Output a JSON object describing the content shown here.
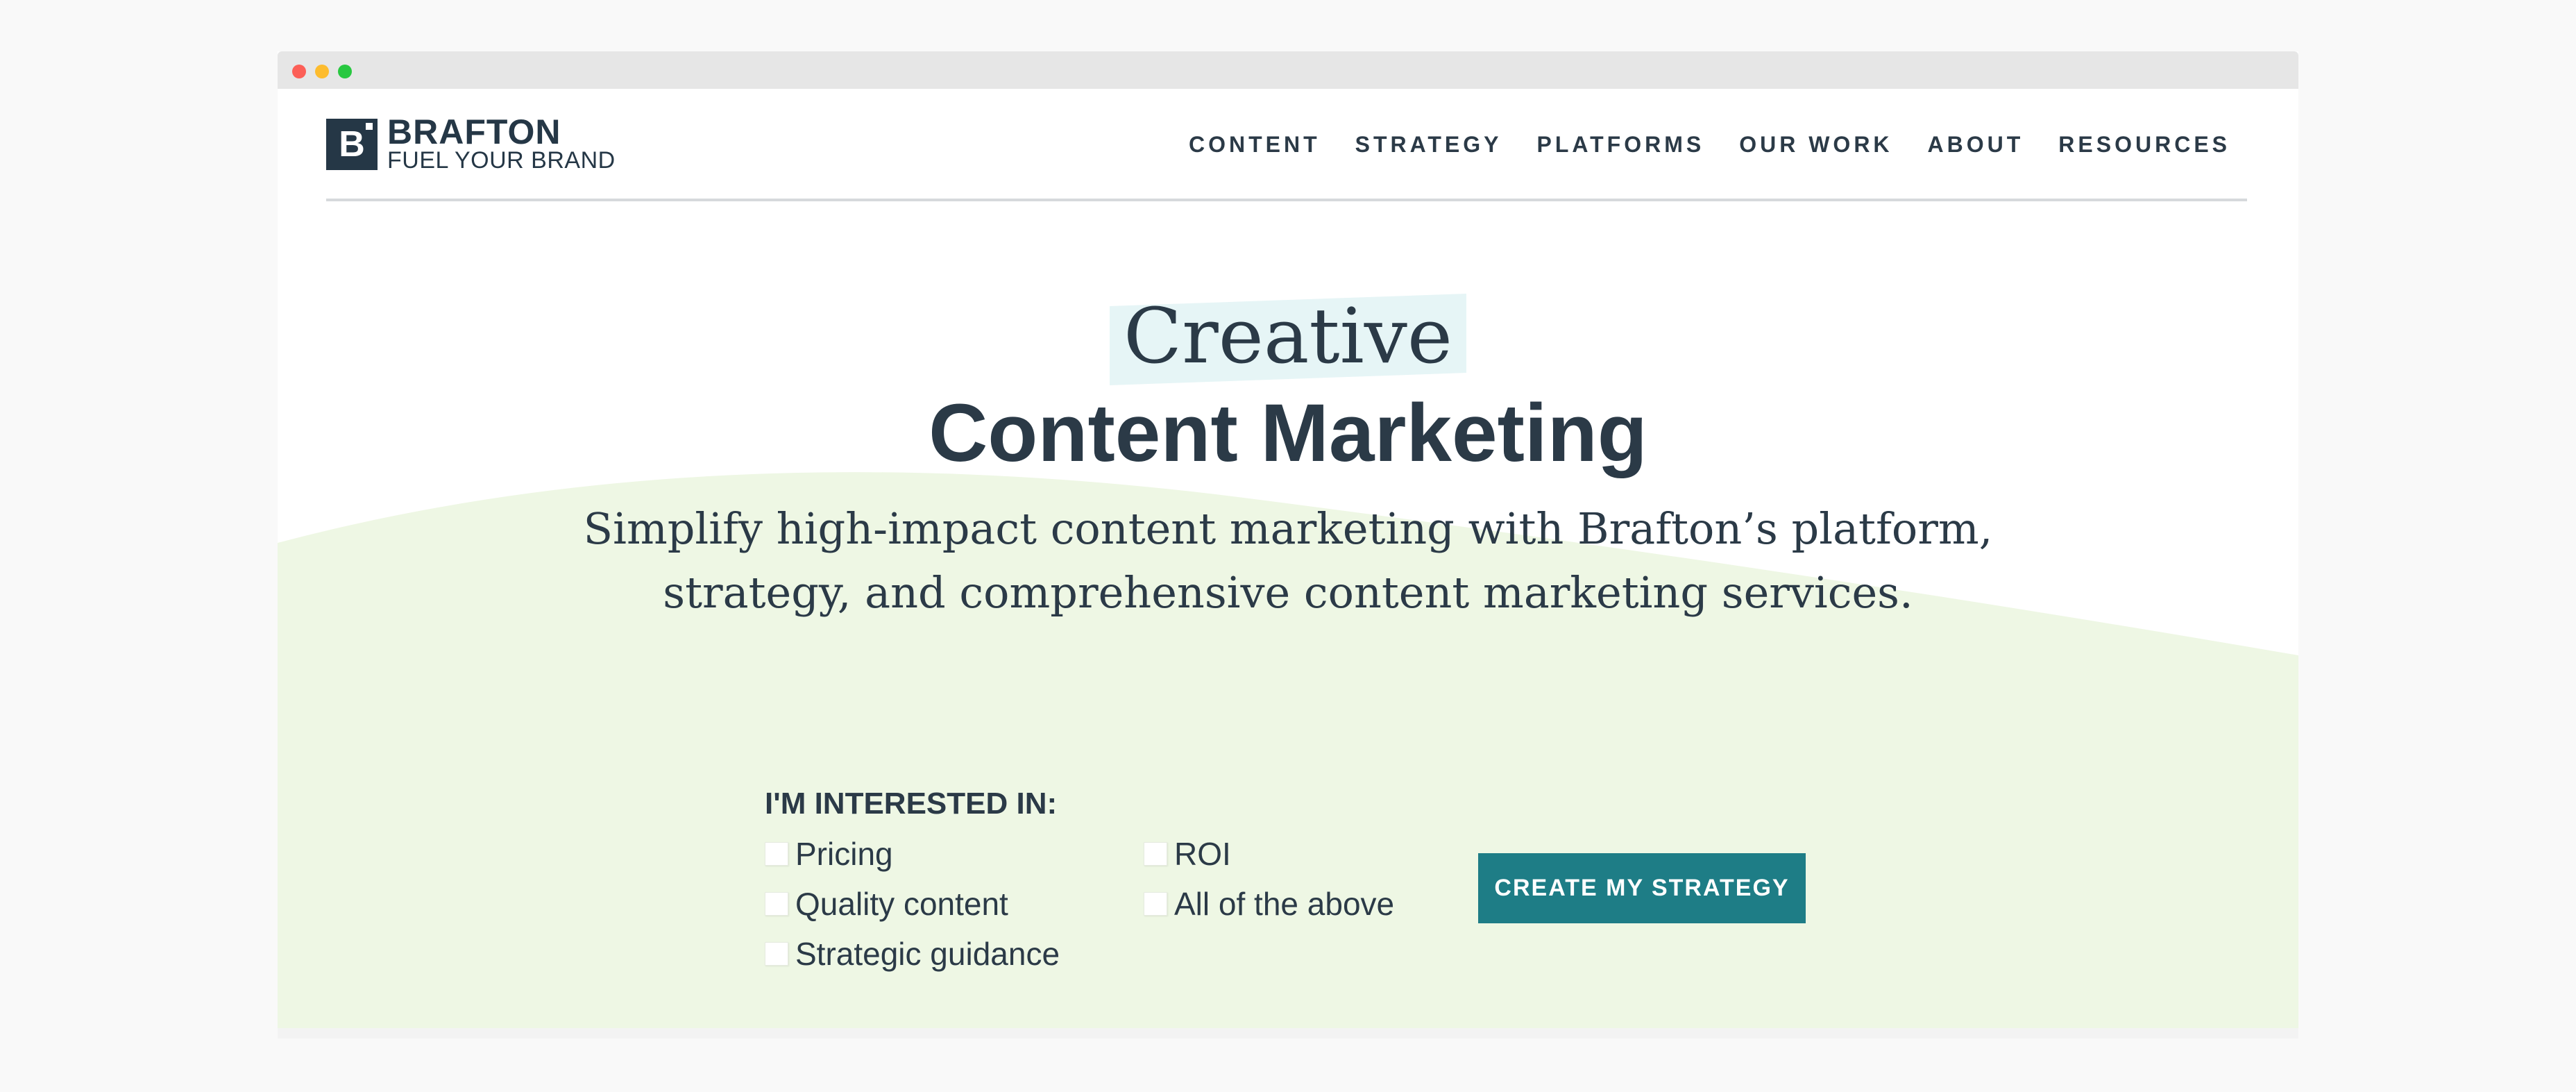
{
  "window": {
    "controls": [
      "close",
      "minimize",
      "maximize"
    ]
  },
  "brand": {
    "logo_letter": "B",
    "name": "BRAFTON",
    "tagline": "FUEL YOUR BRAND"
  },
  "nav": {
    "items": [
      "CONTENT",
      "STRATEGY",
      "PLATFORMS",
      "OUR WORK",
      "ABOUT",
      "RESOURCES"
    ]
  },
  "hero": {
    "title_line1": "Creative",
    "title_line2": "Content Marketing",
    "subtitle": "Simplify high-impact content marketing with Brafton’s platform, strategy, and comprehensive content marketing services."
  },
  "form": {
    "label": "I'M INTERESTED IN:",
    "options": [
      {
        "label": "Pricing",
        "checked": false
      },
      {
        "label": "Quality content",
        "checked": false
      },
      {
        "label": "Strategic guidance",
        "checked": false
      },
      {
        "label": "ROI",
        "checked": false
      },
      {
        "label": "All of the above",
        "checked": false
      }
    ],
    "cta_label": "CREATE MY STRATEGY"
  },
  "colors": {
    "navy": "#2b3a47",
    "teal": "#1e7d86",
    "hero_green": "#eef7e4",
    "highlight": "#e6f5f6"
  }
}
